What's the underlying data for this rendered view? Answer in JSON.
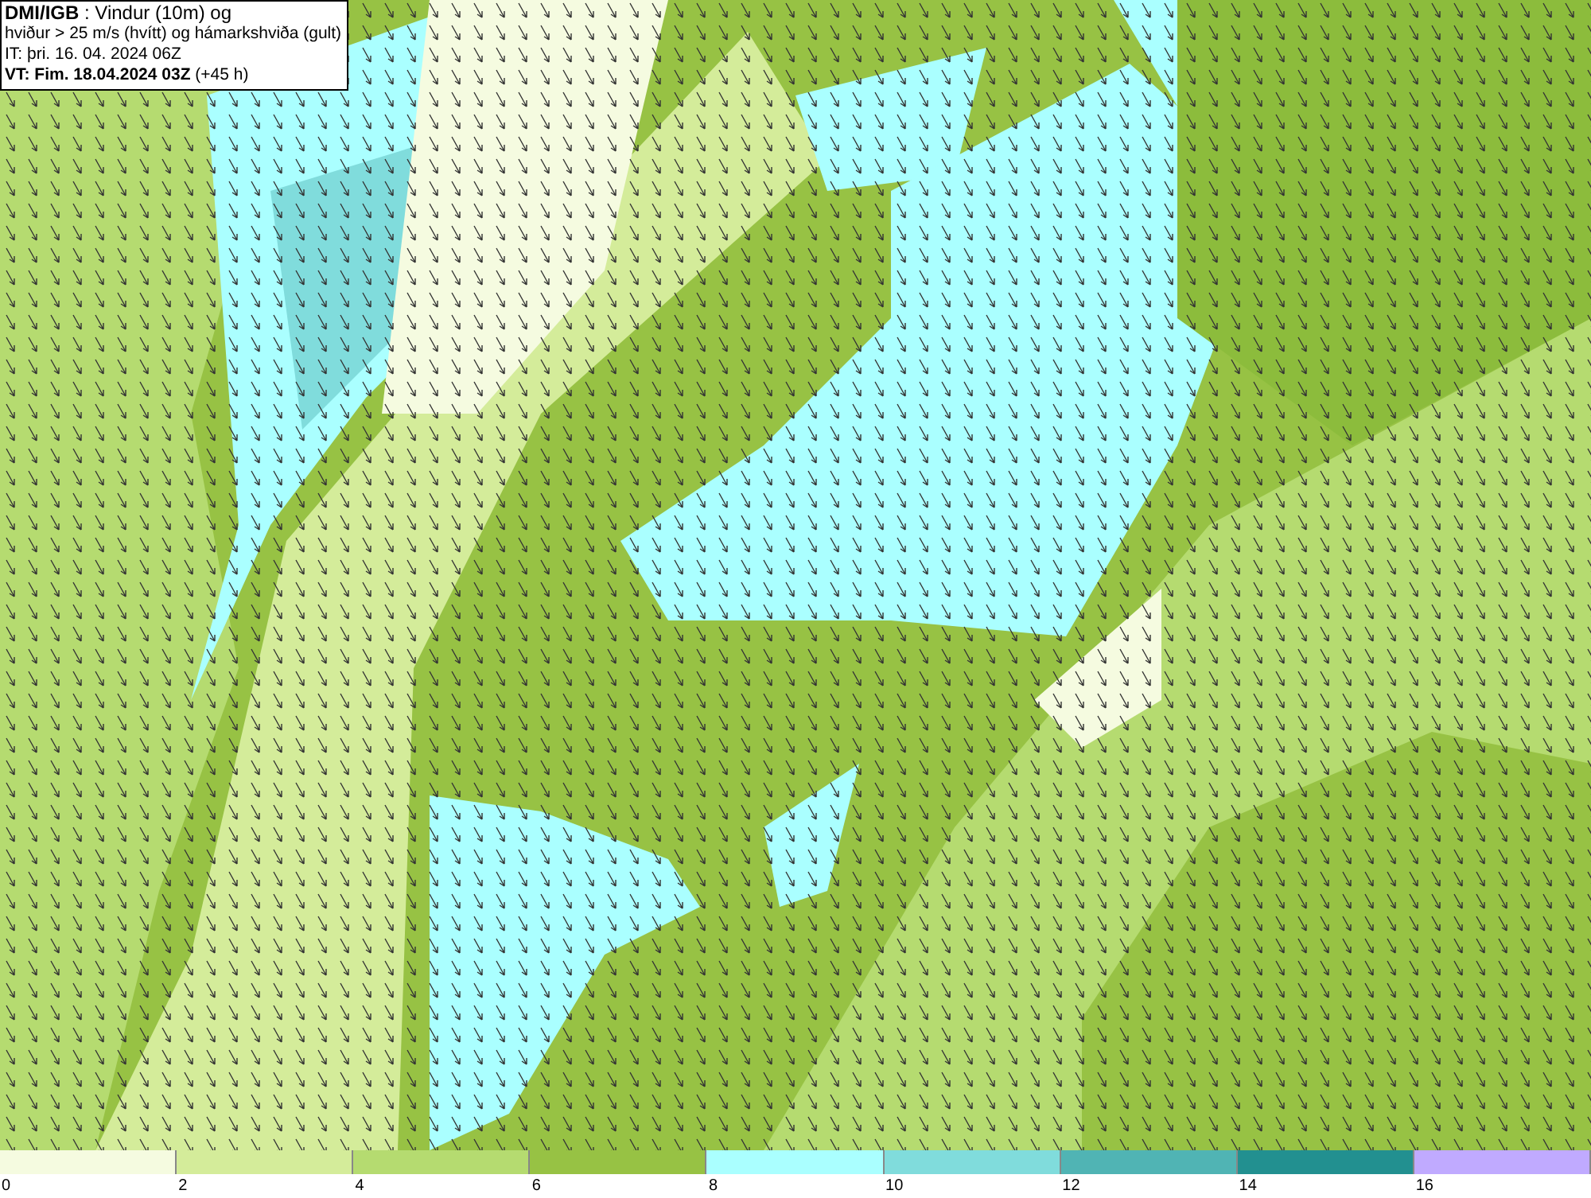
{
  "title_box": {
    "lines": [
      "**DMI/IGB** : Vindur (10m) og",
      "hviður > 25 m/s (hvítt) og hámarkshviða (gult)",
      "IT: þri. 16. 04. 2024 06Z",
      "**VT: Fim. 18.04.2024 03Z** (+45 h)"
    ]
  },
  "legend": {
    "bins": [
      {
        "color": "#f5fbe0",
        "tick": "0"
      },
      {
        "color": "#d4ec9a",
        "tick": "2"
      },
      {
        "color": "#b5db70",
        "tick": "4"
      },
      {
        "color": "#97c244",
        "tick": "6"
      },
      {
        "color": "#aaffff",
        "tick": "8"
      },
      {
        "color": "#80dcdc",
        "tick": "10"
      },
      {
        "color": "#50b4b4",
        "tick": "12"
      },
      {
        "color": "#229090",
        "tick": "14"
      },
      {
        "color": "#c0aaff",
        "tick": "16"
      }
    ]
  }
}
